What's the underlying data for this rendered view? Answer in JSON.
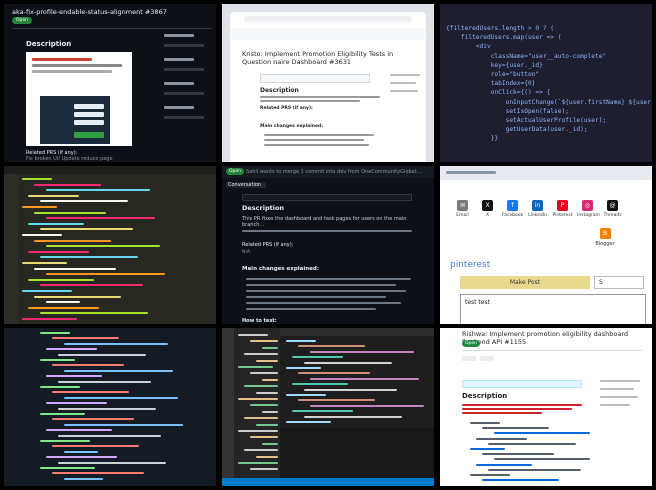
{
  "tile1": {
    "title": "aka-fix-profile-endable-status-alignment #3867",
    "badge": "Open",
    "description": "Description",
    "related": "Related PRS (if any):",
    "footnote": "Fix broken UI/ Update reduce page"
  },
  "tile2": {
    "page_title": "Kristo: Implement Promotion Eligibility Tests in Question naire Dashboard #3631",
    "description": "Description",
    "related": "Related PRS (if any):",
    "main_changes": "Main changes explained:"
  },
  "tile3": {
    "code_lines": [
      "{filteredUsers.length > 0 ? (",
      "    filteredUsers.map(user => (",
      "        <div",
      "            className=\"user__auto-complete\"",
      "            key={user._id}",
      "            role=\"button\"",
      "            tabIndex={0}",
      "            onClick={() => {",
      "                onInputChange(`${user.firstName} ${user.lastName}`);",
      "                setIsOpen(false);",
      "                setActualUserProfile(user);",
      "                getUserData(user._id);",
      "            }}"
    ]
  },
  "tile5": {
    "badge": "Open",
    "header": "Sahil wants to merge 1 commit into dev from OneCommunityGlobal:...",
    "tab": "Conversation",
    "description": "Description",
    "body": "This PR fixes the dashboard and task pages for users on the main branch...",
    "related": "Related PRS (if any):",
    "na": "N/A",
    "main_changes": "Main changes explained:",
    "how_to_test": "How to test:"
  },
  "tile6": {
    "share_items": [
      {
        "label": "Email",
        "glyph": "✉",
        "color": "#7a7a7a"
      },
      {
        "label": "X",
        "glyph": "X",
        "color": "#111111"
      },
      {
        "label": "Facebook",
        "glyph": "f",
        "color": "#1877f2"
      },
      {
        "label": "LinkedIn",
        "glyph": "in",
        "color": "#0a66c2"
      },
      {
        "label": "Pinterest",
        "glyph": "P",
        "color": "#e60023"
      },
      {
        "label": "Instagram",
        "glyph": "◎",
        "color": "#d62976"
      },
      {
        "label": "Threads",
        "glyph": "@",
        "color": "#111111"
      }
    ],
    "blogger": "Blogger",
    "title": "pinterest",
    "make_post": "Make Post",
    "secondary": "S",
    "textarea": "test test"
  },
  "tile9": {
    "title": "Rishwa: Implement promotion eligibility dashboard Backend API #1155",
    "badge": "Open",
    "description": "Description"
  },
  "colors": {
    "github_dark": "#0d1117",
    "open_green": "#238636",
    "link_blue": "#3f7bd8",
    "yellow_button": "#e9d98f"
  }
}
